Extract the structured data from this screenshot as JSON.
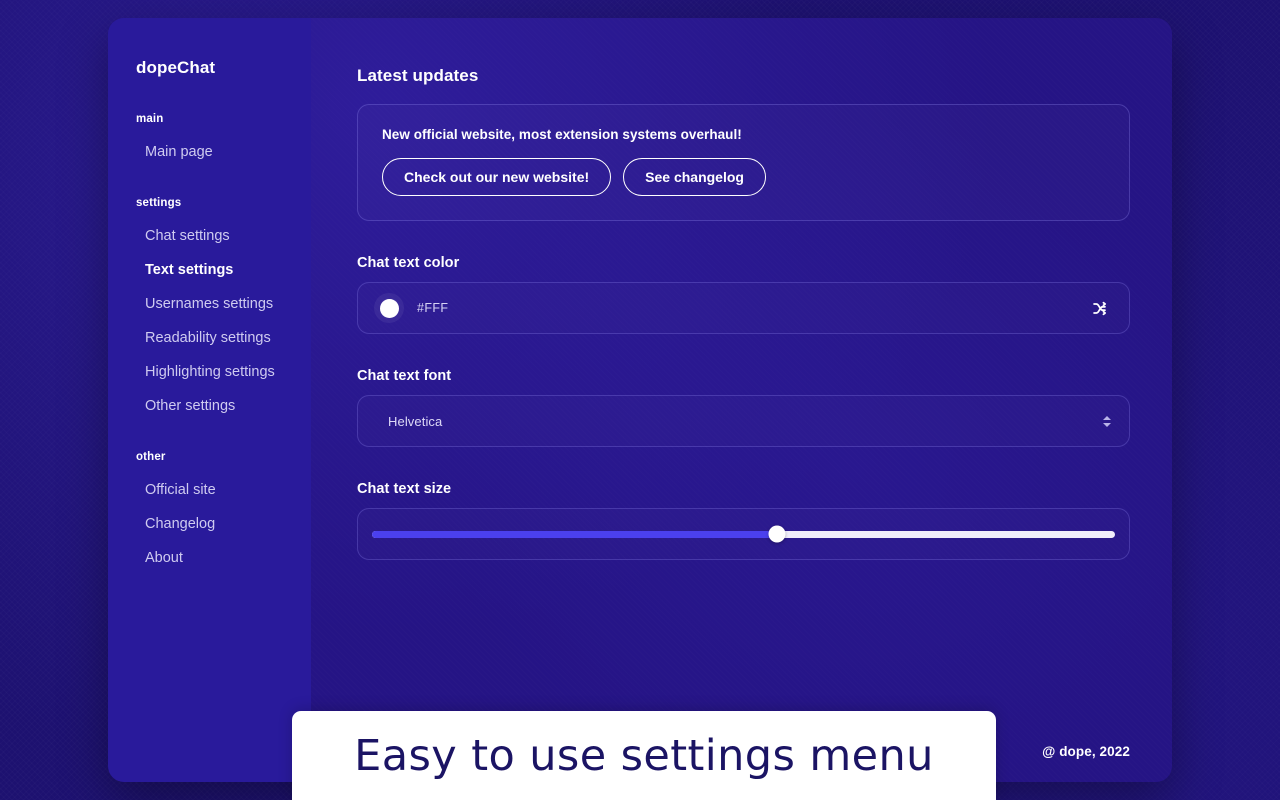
{
  "app": {
    "brand": "dopeChat"
  },
  "sidebar": {
    "groups": [
      {
        "label": "main",
        "items": [
          {
            "label": "Main page",
            "active": false
          }
        ]
      },
      {
        "label": "settings",
        "items": [
          {
            "label": "Chat settings",
            "active": false
          },
          {
            "label": "Text settings",
            "active": true
          },
          {
            "label": "Usernames settings",
            "active": false
          },
          {
            "label": "Readability settings",
            "active": false
          },
          {
            "label": "Highlighting settings",
            "active": false
          },
          {
            "label": "Other settings",
            "active": false
          }
        ]
      },
      {
        "label": "other",
        "items": [
          {
            "label": "Official site",
            "active": false
          },
          {
            "label": "Changelog",
            "active": false
          },
          {
            "label": "About",
            "active": false
          }
        ]
      }
    ]
  },
  "main": {
    "section_title": "Latest updates",
    "update_card": {
      "message": "New official website, most extension systems overhaul!",
      "primary_button": "Check out our new website!",
      "secondary_button": "See changelog"
    },
    "fields": {
      "color": {
        "label": "Chat text color",
        "value": "#FFF",
        "swatch_color": "#FFFFFF",
        "shuffle_icon": "shuffle-icon"
      },
      "font": {
        "label": "Chat text font",
        "value": "Helvetica",
        "chevron_icon": "chevron-up-down-icon"
      },
      "size": {
        "label": "Chat text size",
        "percent": 54.5,
        "fill_color": "#4B40EE",
        "track_color": "#F0EEFB"
      }
    }
  },
  "footer": {
    "copyright": "@ dope, 2022"
  },
  "caption": {
    "text": "Easy to use settings menu"
  }
}
